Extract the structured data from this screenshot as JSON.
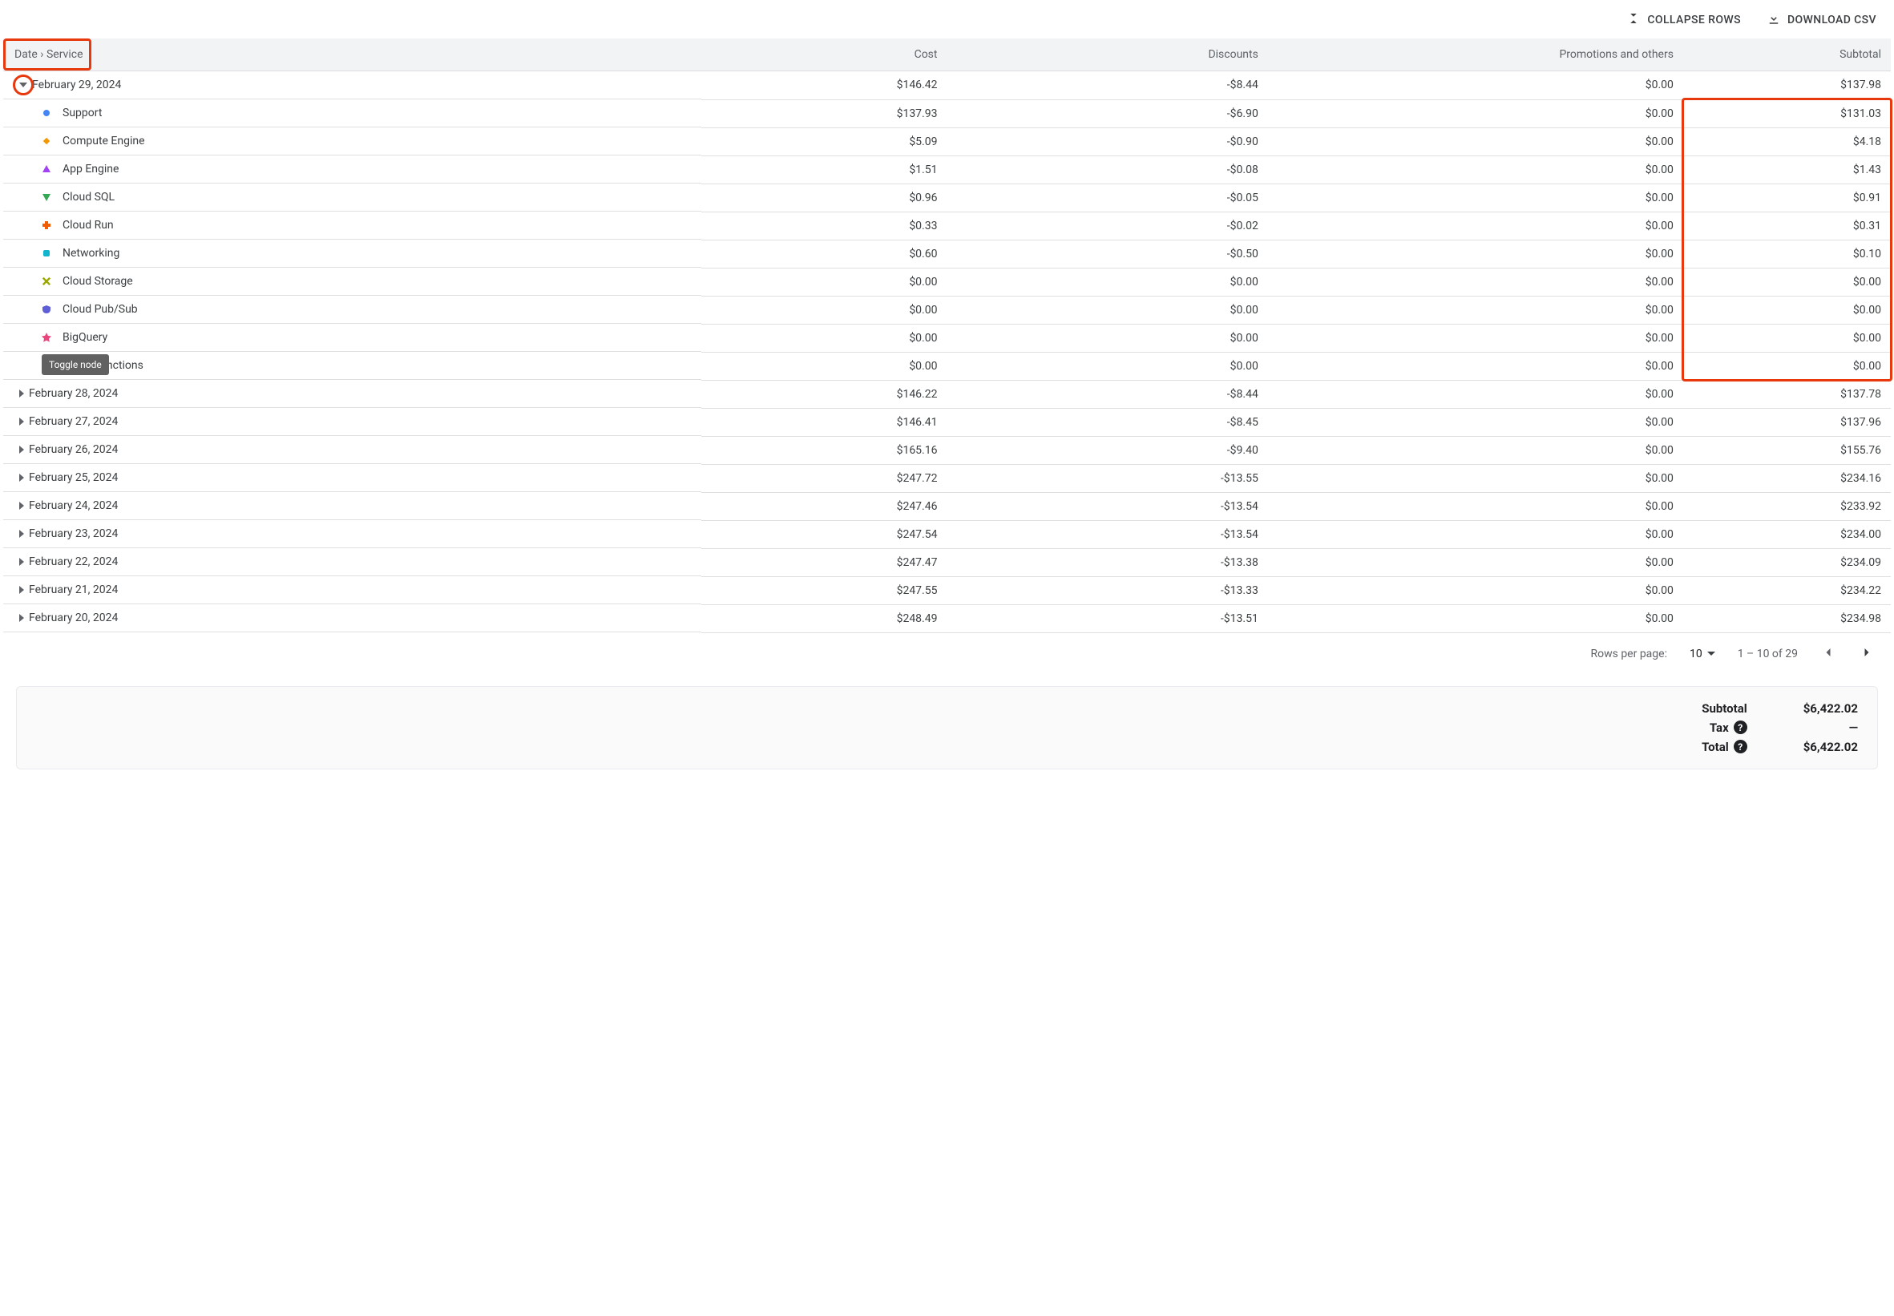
{
  "actions": {
    "collapse": "COLLAPSE ROWS",
    "download": "DOWNLOAD CSV"
  },
  "columns": {
    "group": "Date › Service",
    "cost": "Cost",
    "discounts": "Discounts",
    "promotions": "Promotions and others",
    "subtotal": "Subtotal"
  },
  "tooltip": "Toggle node",
  "rows": [
    {
      "type": "parent",
      "expanded": true,
      "circled": true,
      "label": "February 29, 2024",
      "cost": "$146.42",
      "discounts": "-$8.44",
      "promotions": "$0.00",
      "subtotal": "$137.98"
    },
    {
      "type": "child",
      "marker": "circle",
      "color": "#4285f4",
      "label": "Support",
      "cost": "$137.93",
      "discounts": "-$6.90",
      "promotions": "$0.00",
      "subtotal": "$131.03",
      "hlStart": true
    },
    {
      "type": "child",
      "marker": "diamond",
      "color": "#f29900",
      "label": "Compute Engine",
      "cost": "$5.09",
      "discounts": "-$0.90",
      "promotions": "$0.00",
      "subtotal": "$4.18"
    },
    {
      "type": "child",
      "marker": "triangle-up",
      "color": "#a142f4",
      "label": "App Engine",
      "cost": "$1.51",
      "discounts": "-$0.08",
      "promotions": "$0.00",
      "subtotal": "$1.43"
    },
    {
      "type": "child",
      "marker": "triangle-down",
      "color": "#34a853",
      "label": "Cloud SQL",
      "cost": "$0.96",
      "discounts": "-$0.05",
      "promotions": "$0.00",
      "subtotal": "$0.91"
    },
    {
      "type": "child",
      "marker": "plus",
      "color": "#f25c00",
      "label": "Cloud Run",
      "cost": "$0.33",
      "discounts": "-$0.02",
      "promotions": "$0.00",
      "subtotal": "$0.31"
    },
    {
      "type": "child",
      "marker": "square-round",
      "color": "#12b5cb",
      "label": "Networking",
      "cost": "$0.60",
      "discounts": "-$0.50",
      "promotions": "$0.00",
      "subtotal": "$0.10"
    },
    {
      "type": "child",
      "marker": "x",
      "color": "#9aa700",
      "label": "Cloud Storage",
      "cost": "$0.00",
      "discounts": "$0.00",
      "promotions": "$0.00",
      "subtotal": "$0.00"
    },
    {
      "type": "child",
      "marker": "shield",
      "color": "#5e5ed6",
      "label": "Cloud Pub/Sub",
      "cost": "$0.00",
      "discounts": "$0.00",
      "promotions": "$0.00",
      "subtotal": "$0.00"
    },
    {
      "type": "child",
      "marker": "star",
      "color": "#e8467c",
      "label": "BigQuery",
      "cost": "$0.00",
      "discounts": "$0.00",
      "promotions": "$0.00",
      "subtotal": "$0.00"
    },
    {
      "type": "child",
      "marker": "square-round",
      "color": "#12b5cb",
      "label": "Cloud Functions",
      "cost": "$0.00",
      "discounts": "$0.00",
      "promotions": "$0.00",
      "subtotal": "$0.00",
      "hlEnd": true,
      "showTooltip": true
    },
    {
      "type": "parent",
      "expanded": false,
      "label": "February 28, 2024",
      "cost": "$146.22",
      "discounts": "-$8.44",
      "promotions": "$0.00",
      "subtotal": "$137.78"
    },
    {
      "type": "parent",
      "expanded": false,
      "label": "February 27, 2024",
      "cost": "$146.41",
      "discounts": "-$8.45",
      "promotions": "$0.00",
      "subtotal": "$137.96"
    },
    {
      "type": "parent",
      "expanded": false,
      "label": "February 26, 2024",
      "cost": "$165.16",
      "discounts": "-$9.40",
      "promotions": "$0.00",
      "subtotal": "$155.76"
    },
    {
      "type": "parent",
      "expanded": false,
      "label": "February 25, 2024",
      "cost": "$247.72",
      "discounts": "-$13.55",
      "promotions": "$0.00",
      "subtotal": "$234.16"
    },
    {
      "type": "parent",
      "expanded": false,
      "label": "February 24, 2024",
      "cost": "$247.46",
      "discounts": "-$13.54",
      "promotions": "$0.00",
      "subtotal": "$233.92"
    },
    {
      "type": "parent",
      "expanded": false,
      "label": "February 23, 2024",
      "cost": "$247.54",
      "discounts": "-$13.54",
      "promotions": "$0.00",
      "subtotal": "$234.00"
    },
    {
      "type": "parent",
      "expanded": false,
      "label": "February 22, 2024",
      "cost": "$247.47",
      "discounts": "-$13.38",
      "promotions": "$0.00",
      "subtotal": "$234.09"
    },
    {
      "type": "parent",
      "expanded": false,
      "label": "February 21, 2024",
      "cost": "$247.55",
      "discounts": "-$13.33",
      "promotions": "$0.00",
      "subtotal": "$234.22"
    },
    {
      "type": "parent",
      "expanded": false,
      "label": "February 20, 2024",
      "cost": "$248.49",
      "discounts": "-$13.51",
      "promotions": "$0.00",
      "subtotal": "$234.98"
    }
  ],
  "pager": {
    "rows_label": "Rows per page:",
    "rows_value": "10",
    "range": "1 – 10 of 29"
  },
  "totals": {
    "subtotal_label": "Subtotal",
    "subtotal_value": "$6,422.02",
    "tax_label": "Tax",
    "tax_value": "—",
    "total_label": "Total",
    "total_value": "$6,422.02"
  }
}
